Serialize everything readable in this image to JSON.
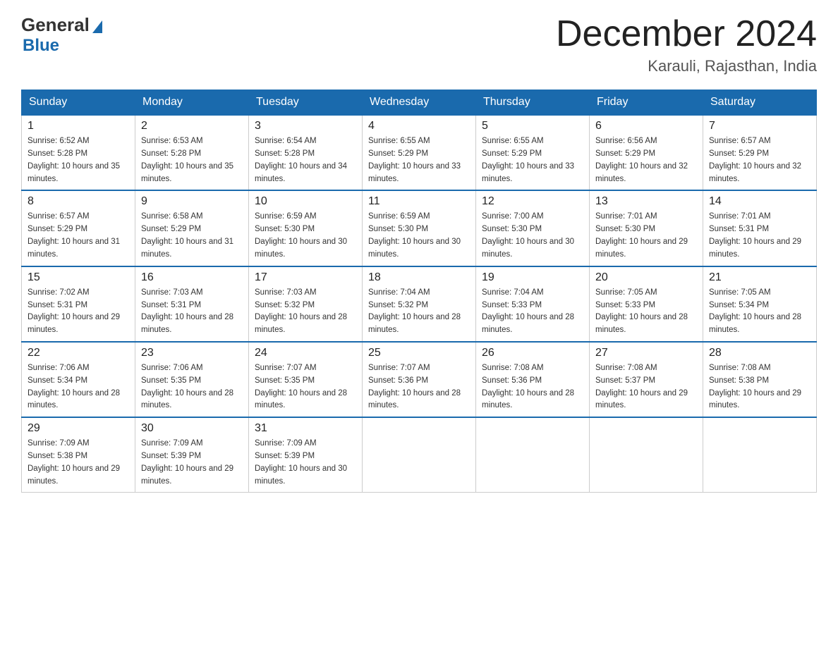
{
  "logo": {
    "text_general": "General",
    "text_blue": "Blue"
  },
  "header": {
    "title": "December 2024",
    "subtitle": "Karauli, Rajasthan, India"
  },
  "days_of_week": [
    "Sunday",
    "Monday",
    "Tuesday",
    "Wednesday",
    "Thursday",
    "Friday",
    "Saturday"
  ],
  "weeks": [
    [
      {
        "day": "1",
        "sunrise": "6:52 AM",
        "sunset": "5:28 PM",
        "daylight": "10 hours and 35 minutes."
      },
      {
        "day": "2",
        "sunrise": "6:53 AM",
        "sunset": "5:28 PM",
        "daylight": "10 hours and 35 minutes."
      },
      {
        "day": "3",
        "sunrise": "6:54 AM",
        "sunset": "5:28 PM",
        "daylight": "10 hours and 34 minutes."
      },
      {
        "day": "4",
        "sunrise": "6:55 AM",
        "sunset": "5:29 PM",
        "daylight": "10 hours and 33 minutes."
      },
      {
        "day": "5",
        "sunrise": "6:55 AM",
        "sunset": "5:29 PM",
        "daylight": "10 hours and 33 minutes."
      },
      {
        "day": "6",
        "sunrise": "6:56 AM",
        "sunset": "5:29 PM",
        "daylight": "10 hours and 32 minutes."
      },
      {
        "day": "7",
        "sunrise": "6:57 AM",
        "sunset": "5:29 PM",
        "daylight": "10 hours and 32 minutes."
      }
    ],
    [
      {
        "day": "8",
        "sunrise": "6:57 AM",
        "sunset": "5:29 PM",
        "daylight": "10 hours and 31 minutes."
      },
      {
        "day": "9",
        "sunrise": "6:58 AM",
        "sunset": "5:29 PM",
        "daylight": "10 hours and 31 minutes."
      },
      {
        "day": "10",
        "sunrise": "6:59 AM",
        "sunset": "5:30 PM",
        "daylight": "10 hours and 30 minutes."
      },
      {
        "day": "11",
        "sunrise": "6:59 AM",
        "sunset": "5:30 PM",
        "daylight": "10 hours and 30 minutes."
      },
      {
        "day": "12",
        "sunrise": "7:00 AM",
        "sunset": "5:30 PM",
        "daylight": "10 hours and 30 minutes."
      },
      {
        "day": "13",
        "sunrise": "7:01 AM",
        "sunset": "5:30 PM",
        "daylight": "10 hours and 29 minutes."
      },
      {
        "day": "14",
        "sunrise": "7:01 AM",
        "sunset": "5:31 PM",
        "daylight": "10 hours and 29 minutes."
      }
    ],
    [
      {
        "day": "15",
        "sunrise": "7:02 AM",
        "sunset": "5:31 PM",
        "daylight": "10 hours and 29 minutes."
      },
      {
        "day": "16",
        "sunrise": "7:03 AM",
        "sunset": "5:31 PM",
        "daylight": "10 hours and 28 minutes."
      },
      {
        "day": "17",
        "sunrise": "7:03 AM",
        "sunset": "5:32 PM",
        "daylight": "10 hours and 28 minutes."
      },
      {
        "day": "18",
        "sunrise": "7:04 AM",
        "sunset": "5:32 PM",
        "daylight": "10 hours and 28 minutes."
      },
      {
        "day": "19",
        "sunrise": "7:04 AM",
        "sunset": "5:33 PM",
        "daylight": "10 hours and 28 minutes."
      },
      {
        "day": "20",
        "sunrise": "7:05 AM",
        "sunset": "5:33 PM",
        "daylight": "10 hours and 28 minutes."
      },
      {
        "day": "21",
        "sunrise": "7:05 AM",
        "sunset": "5:34 PM",
        "daylight": "10 hours and 28 minutes."
      }
    ],
    [
      {
        "day": "22",
        "sunrise": "7:06 AM",
        "sunset": "5:34 PM",
        "daylight": "10 hours and 28 minutes."
      },
      {
        "day": "23",
        "sunrise": "7:06 AM",
        "sunset": "5:35 PM",
        "daylight": "10 hours and 28 minutes."
      },
      {
        "day": "24",
        "sunrise": "7:07 AM",
        "sunset": "5:35 PM",
        "daylight": "10 hours and 28 minutes."
      },
      {
        "day": "25",
        "sunrise": "7:07 AM",
        "sunset": "5:36 PM",
        "daylight": "10 hours and 28 minutes."
      },
      {
        "day": "26",
        "sunrise": "7:08 AM",
        "sunset": "5:36 PM",
        "daylight": "10 hours and 28 minutes."
      },
      {
        "day": "27",
        "sunrise": "7:08 AM",
        "sunset": "5:37 PM",
        "daylight": "10 hours and 29 minutes."
      },
      {
        "day": "28",
        "sunrise": "7:08 AM",
        "sunset": "5:38 PM",
        "daylight": "10 hours and 29 minutes."
      }
    ],
    [
      {
        "day": "29",
        "sunrise": "7:09 AM",
        "sunset": "5:38 PM",
        "daylight": "10 hours and 29 minutes."
      },
      {
        "day": "30",
        "sunrise": "7:09 AM",
        "sunset": "5:39 PM",
        "daylight": "10 hours and 29 minutes."
      },
      {
        "day": "31",
        "sunrise": "7:09 AM",
        "sunset": "5:39 PM",
        "daylight": "10 hours and 30 minutes."
      },
      null,
      null,
      null,
      null
    ]
  ]
}
